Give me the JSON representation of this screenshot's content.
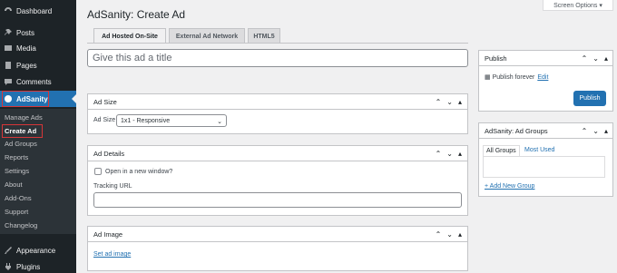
{
  "sidebar": {
    "items": [
      {
        "label": "Dashboard",
        "icon": "dashboard-icon"
      },
      {
        "label": "Posts",
        "icon": "pin-icon"
      },
      {
        "label": "Media",
        "icon": "media-icon"
      },
      {
        "label": "Pages",
        "icon": "pages-icon"
      },
      {
        "label": "Comments",
        "icon": "comment-icon"
      },
      {
        "label": "AdSanity",
        "icon": "adsanity-icon"
      },
      {
        "label": "Appearance",
        "icon": "brush-icon"
      },
      {
        "label": "Plugins",
        "icon": "plugin-icon"
      }
    ],
    "submenu": [
      "Manage Ads",
      "Create Ad",
      "Ad Groups",
      "Reports",
      "Settings",
      "About",
      "Add-Ons",
      "Support",
      "Changelog"
    ]
  },
  "header": {
    "screen_options": "Screen Options ▾",
    "title": "AdSanity: Create Ad"
  },
  "tabs": [
    "Ad Hosted On-Site",
    "External Ad Network",
    "HTML5"
  ],
  "title_placeholder": "Give this ad a title",
  "ad_size": {
    "heading": "Ad Size",
    "label": "Ad Size",
    "selected": "1x1 - Responsive"
  },
  "ad_details": {
    "heading": "Ad Details",
    "checkbox_label": "Open in a new window?",
    "tracking_label": "Tracking URL"
  },
  "ad_image": {
    "heading": "Ad Image",
    "link": "Set ad image"
  },
  "publish": {
    "heading": "Publish",
    "status": "Publish forever",
    "edit": "Edit",
    "button": "Publish"
  },
  "ad_groups": {
    "heading": "AdSanity: Ad Groups",
    "tab_all": "All Groups",
    "tab_used": "Most Used",
    "add_link": "+ Add New Group"
  },
  "colors": {
    "sidebar": "#1d2327",
    "accent": "#2271b1",
    "highlight": "#d63638"
  }
}
